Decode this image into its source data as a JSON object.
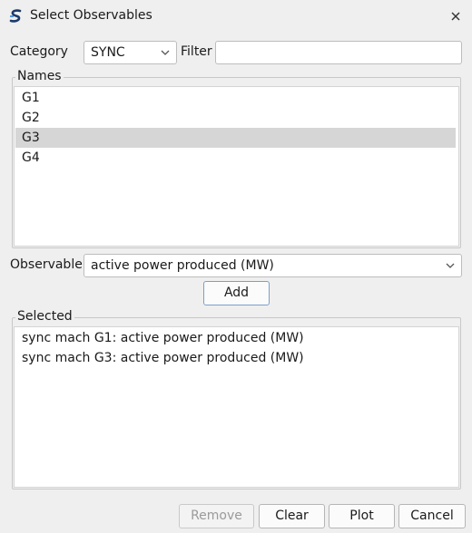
{
  "window": {
    "title": "Select Observables"
  },
  "category": {
    "label": "Category",
    "selected": "SYNC"
  },
  "filter": {
    "label": "Filter",
    "value": ""
  },
  "names": {
    "title": "Names",
    "items": [
      "G1",
      "G2",
      "G3",
      "G4"
    ],
    "selected_index": 2
  },
  "observable": {
    "label": "Observable",
    "selected": "active power produced (MW)"
  },
  "add_button": "Add",
  "selected": {
    "title": "Selected",
    "items": [
      "sync mach G1: active power produced (MW)",
      "sync mach G3: active power produced (MW)"
    ]
  },
  "buttons": {
    "remove": "Remove",
    "clear": "Clear",
    "plot": "Plot",
    "cancel": "Cancel"
  },
  "icons": {
    "app": "app-logo-icon",
    "close": "close-icon",
    "chevron": "chevron-down-icon"
  }
}
